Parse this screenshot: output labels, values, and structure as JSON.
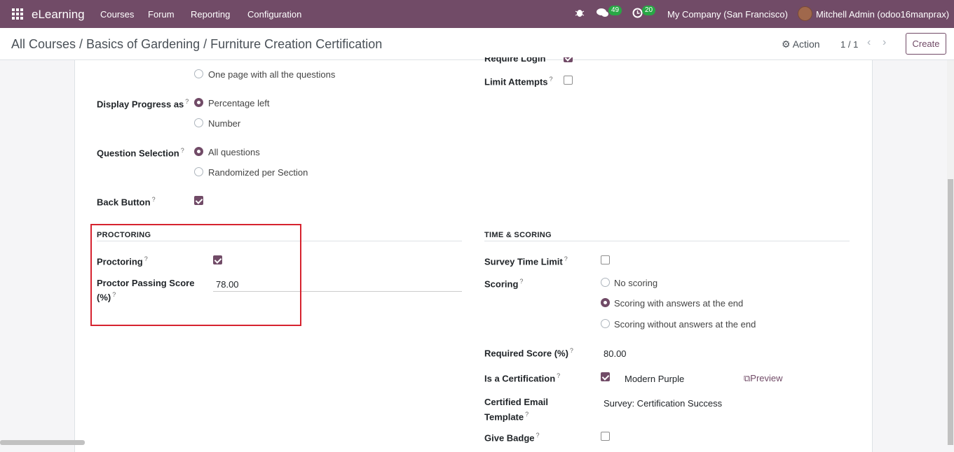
{
  "navbar": {
    "app_name": "eLearning",
    "menus": [
      "Courses",
      "Forum",
      "Reporting",
      "Configuration"
    ],
    "messages_count": "49",
    "activities_count": "20",
    "company": "My Company (San Francisco)",
    "user": "Mitchell Admin (odoo16manprax)"
  },
  "control_panel": {
    "breadcrumb": "All Courses / Basics of Gardening / Furniture Creation Certification",
    "action_label": "Action",
    "pager": "1 / 1",
    "create_label": "Create"
  },
  "left": {
    "layout_option": "One page with all the questions",
    "display_progress": {
      "label": "Display Progress as",
      "options": [
        "Percentage left",
        "Number"
      ],
      "selected": "Percentage left"
    },
    "question_selection": {
      "label": "Question Selection",
      "options": [
        "All questions",
        "Randomized per Section"
      ],
      "selected": "All questions"
    },
    "back_button": {
      "label": "Back Button",
      "checked": true
    }
  },
  "right_top": {
    "require_login_label": "Require Login",
    "limit_attempts": {
      "label": "Limit Attempts",
      "checked": false
    }
  },
  "proctoring": {
    "section_title": "PROCTORING",
    "proctoring_label": "Proctoring",
    "proctoring_checked": true,
    "passing_score_label": "Proctor Passing Score",
    "passing_score_label2": "(%)",
    "passing_score_value": "78.00"
  },
  "time_scoring": {
    "section_title": "TIME & SCORING",
    "time_limit_label": "Survey Time Limit",
    "scoring_label": "Scoring",
    "scoring_options": [
      "No scoring",
      "Scoring with answers at the end",
      "Scoring without answers at the end"
    ],
    "scoring_selected": "Scoring with answers at the end",
    "required_score_label": "Required Score (%)",
    "required_score_value": "80.00",
    "certification_label": "Is a Certification",
    "certification_template": "Modern Purple",
    "preview_label": "Preview",
    "email_template_label": "Certified Email",
    "email_template_label2": "Template",
    "email_template_value": "Survey: Certification Success",
    "give_badge_label": "Give Badge"
  },
  "colors": {
    "brand": "#714b67",
    "highlight": "#d6232f",
    "badge": "#28a745"
  }
}
